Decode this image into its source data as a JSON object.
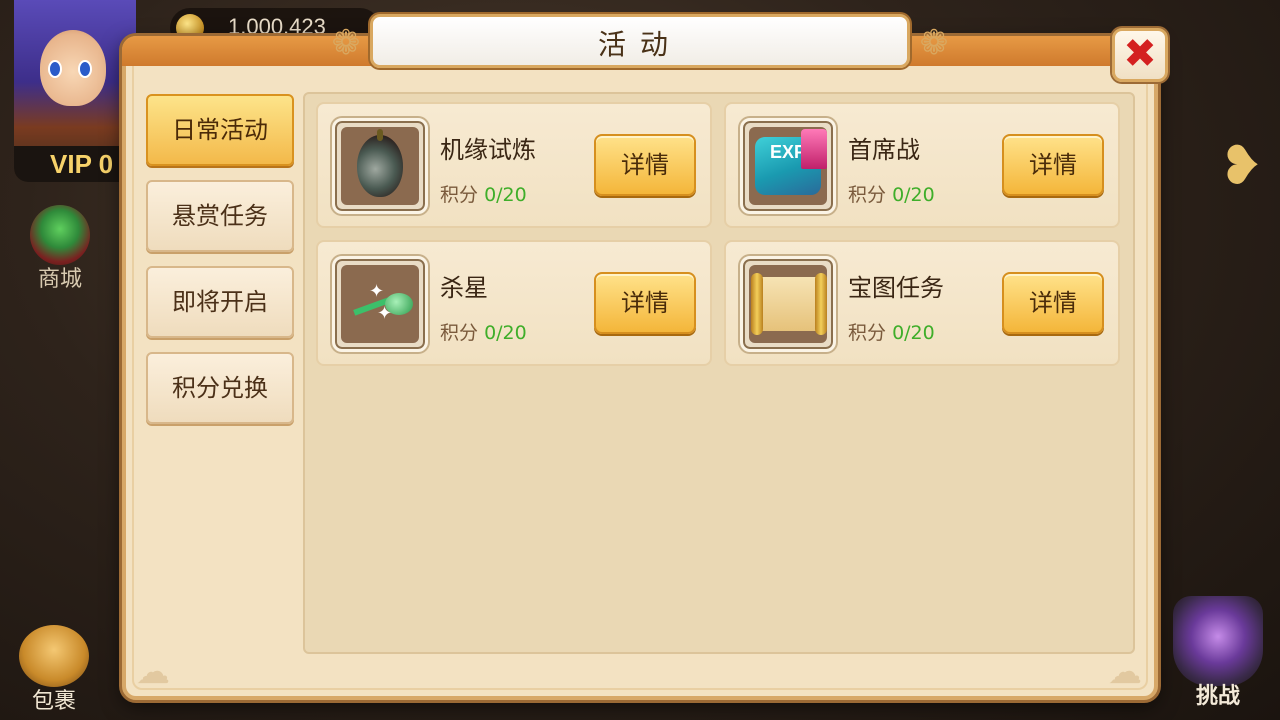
{
  "hud": {
    "vip_label": "VIP 0",
    "gold_amount": "1,000,423",
    "shop_label": "商城",
    "bag_label": "包裹",
    "challenge_label": "挑战",
    "next_arrow": "❥"
  },
  "dialog": {
    "title": "活动",
    "close_symbol": "✖"
  },
  "tabs": [
    {
      "label": "日常活动",
      "active": true
    },
    {
      "label": "悬赏任务",
      "active": false
    },
    {
      "label": "即将开启",
      "active": false
    },
    {
      "label": "积分兑换",
      "active": false
    }
  ],
  "activities": [
    {
      "name": "机缘试炼",
      "score_label": "积分",
      "score_value": "0/20",
      "button": "详情",
      "icon": "gourd-icon"
    },
    {
      "name": "首席战",
      "score_label": "积分",
      "score_value": "0/20",
      "button": "详情",
      "icon": "exp-icon"
    },
    {
      "name": "杀星",
      "score_label": "积分",
      "score_value": "0/20",
      "button": "详情",
      "icon": "star-icon"
    },
    {
      "name": "宝图任务",
      "score_label": "积分",
      "score_value": "0/20",
      "button": "详情",
      "icon": "scroll-icon"
    }
  ],
  "colors": {
    "accent": "#f4b63a",
    "score_value": "#3fae2a",
    "close": "#d42020"
  }
}
